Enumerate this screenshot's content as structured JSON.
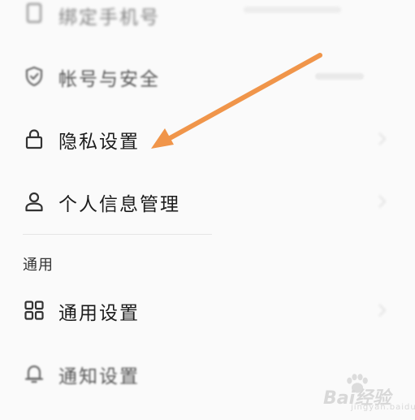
{
  "settings": {
    "items": [
      {
        "label": "绑定手机号",
        "right": "",
        "icon": "phone-icon"
      },
      {
        "label": "帐号与安全",
        "right": "",
        "icon": "shield-check-icon"
      },
      {
        "label": "隐私设置",
        "right": "",
        "icon": "lock-icon"
      },
      {
        "label": "个人信息管理",
        "right": "",
        "icon": "person-icon"
      }
    ],
    "section_general": "通用",
    "general_items": [
      {
        "label": "通用设置",
        "icon": "grid-icon"
      },
      {
        "label": "通知设置",
        "icon": "bell-icon"
      }
    ]
  },
  "annotation": {
    "arrow_color": "#f0954a"
  },
  "watermark": {
    "text": "Bai经验",
    "sub": "jingyan.baidu.com"
  }
}
